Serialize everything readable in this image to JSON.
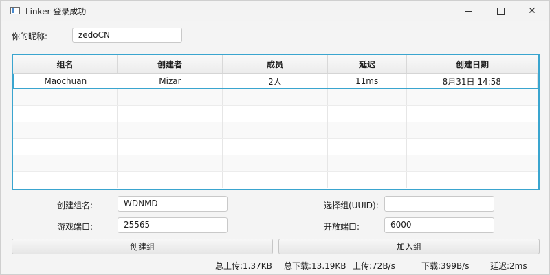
{
  "window": {
    "title": "Linker 登录成功",
    "controls": [
      "minimize",
      "maximize",
      "close"
    ]
  },
  "nickname": {
    "label": "你的昵称:",
    "value": "zedoCN"
  },
  "table": {
    "headers": [
      "组名",
      "创建者",
      "成员",
      "延迟",
      "创建日期"
    ],
    "rows": [
      [
        "Maochuan",
        "Mizar",
        "2人",
        "11ms",
        "8月31日 14:58"
      ]
    ]
  },
  "form": {
    "create_group_label": "创建组名:",
    "create_group_value": "WDNMD",
    "game_port_label": "游戏端口:",
    "game_port_value": "25565",
    "select_group_label": "选择组(UUID):",
    "select_group_value": "",
    "open_port_label": "开放端口:",
    "open_port_value": "6000"
  },
  "buttons": {
    "create": "创建组",
    "join": "加入组"
  },
  "status": {
    "total_upload": "总上传:1.37KB",
    "total_download": "总下载:13.19KB",
    "upload_speed": "上传:72B/s",
    "download_speed": "下载:399B/s",
    "latency": "延迟:2ms"
  }
}
